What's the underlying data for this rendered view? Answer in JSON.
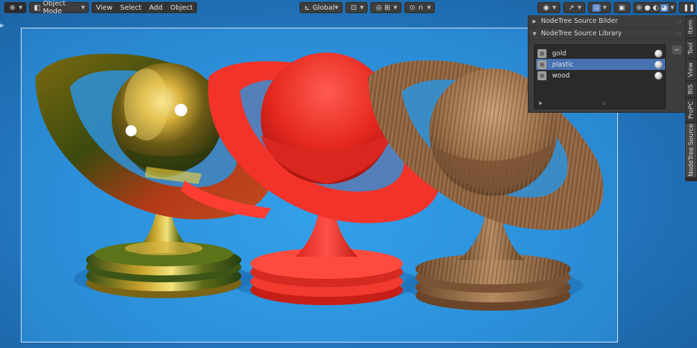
{
  "header": {
    "mode_label": "Object Mode",
    "menus": [
      "View",
      "Select",
      "Add",
      "Object"
    ],
    "orientation_label": "Global",
    "icons": {
      "editor_type": "globe-cursor-icon",
      "mode": "cube-icon",
      "orientation": "axes-icon",
      "pivot": "pivot-icon",
      "snap": "magnet-icon",
      "proportional": "circle-dot-icon",
      "falloff": "falloff-curve-icon",
      "visibility": "eye-icon",
      "gizmo": "gizmo-arrows-icon",
      "overlay": "overlay-circles-icon",
      "xray": "xray-icon",
      "shading_wire": "wireframe-sphere-icon",
      "shading_solid": "solid-sphere-icon",
      "shading_material": "material-sphere-icon",
      "shading_render": "rendered-sphere-icon",
      "pause": "pause-icon"
    }
  },
  "sidebar": {
    "tabs": [
      "Item",
      "Tool",
      "View",
      "BIS",
      "ProPC",
      "NodeTree Source"
    ],
    "active_tab": "NodeTree Source"
  },
  "panel": {
    "sections": [
      {
        "label": "NodeTree Source Bilder",
        "expanded": false
      },
      {
        "label": "NodeTree Source Library",
        "expanded": true
      }
    ],
    "library_items": [
      {
        "label": "gold",
        "selected": false
      },
      {
        "label": "plastic",
        "selected": true
      },
      {
        "label": "wood",
        "selected": false
      }
    ],
    "remove_label": "−"
  },
  "colors": {
    "accent_selected": "#4772b3",
    "background_blue": "#2d92dc",
    "gold": "#c9a227",
    "plastic": "#e8302a",
    "wood": "#8a6040"
  }
}
